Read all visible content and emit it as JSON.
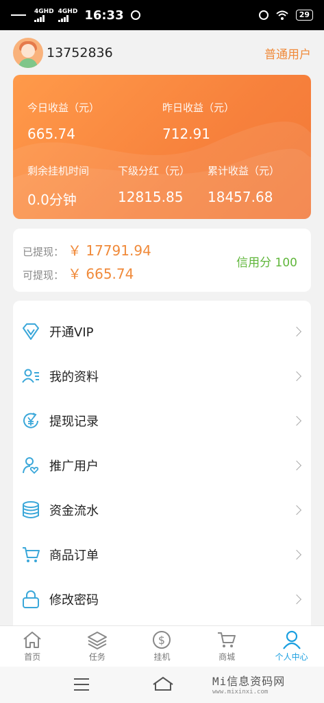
{
  "status_bar": {
    "network_1": "4GHD",
    "network_2": "4GHD",
    "time": "16:33",
    "battery": "29"
  },
  "header": {
    "username": "13752836",
    "user_level": "普通用户"
  },
  "stats": {
    "today_label": "今日收益（元）",
    "today_value": "665.74",
    "yesterday_label": "昨日收益（元）",
    "yesterday_value": "712.91",
    "remaining_label": "剩余挂机时间",
    "remaining_value": "0.0分钟",
    "dividend_label": "下级分红（元）",
    "dividend_value": "12815.85",
    "total_label": "累计收益（元）",
    "total_value": "18457.68"
  },
  "withdraw": {
    "withdrawn_label": "已提现：",
    "withdrawn_value": "￥ 17791.94",
    "available_label": "可提现：",
    "available_value": "￥ 665.74",
    "credit": "信用分 100"
  },
  "menu": [
    {
      "label": "开通VIP",
      "icon": "diamond-icon"
    },
    {
      "label": "我的资料",
      "icon": "profile-card-icon"
    },
    {
      "label": "提现记录",
      "icon": "yuan-refresh-icon"
    },
    {
      "label": "推广用户",
      "icon": "user-heart-icon"
    },
    {
      "label": "资金流水",
      "icon": "coin-stack-icon"
    },
    {
      "label": "商品订单",
      "icon": "cart-icon"
    },
    {
      "label": "修改密码",
      "icon": "lock-icon"
    }
  ],
  "tabs": [
    {
      "label": "首页",
      "icon": "home-icon"
    },
    {
      "label": "任务",
      "icon": "layers-icon"
    },
    {
      "label": "挂机",
      "icon": "dollar-circle-icon"
    },
    {
      "label": "商城",
      "icon": "cart-icon"
    },
    {
      "label": "个人中心",
      "icon": "person-icon"
    }
  ],
  "colors": {
    "accent_orange": "#f7813c",
    "value_orange": "#f08a3a",
    "credit_green": "#5fb63a",
    "icon_blue": "#3aa7d9",
    "tab_active": "#1a9fe0"
  },
  "watermark": {
    "line1": "Mi信息资码网",
    "line2": "www.mixinxi.com"
  }
}
